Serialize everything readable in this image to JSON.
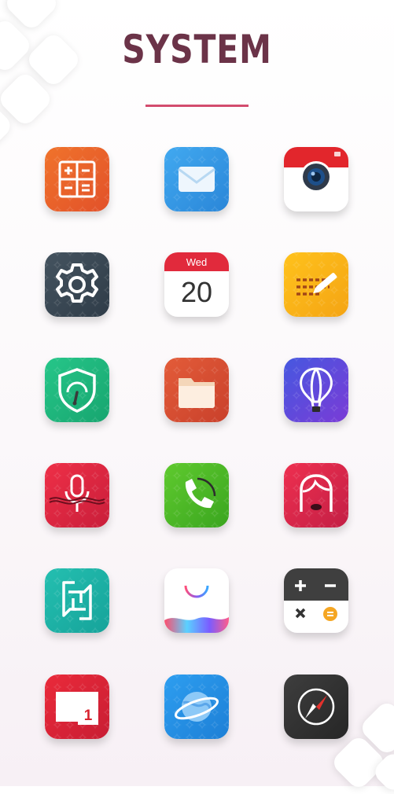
{
  "header": {
    "title": "SYSTEM"
  },
  "calendar_icon": {
    "day": "Wed",
    "date": "20"
  },
  "date_icon": {
    "number": "1"
  },
  "colors": {
    "title": "#6b3348",
    "accent_line": "#d34c6e"
  },
  "apps": [
    {
      "icon": "calculator-icon"
    },
    {
      "icon": "mail-icon"
    },
    {
      "icon": "camera-icon"
    },
    {
      "icon": "settings-gear-icon"
    },
    {
      "icon": "calendar-icon"
    },
    {
      "icon": "notes-icon"
    },
    {
      "icon": "security-shield-icon"
    },
    {
      "icon": "files-folder-icon"
    },
    {
      "icon": "hot-air-balloon-icon"
    },
    {
      "icon": "voice-recorder-icon"
    },
    {
      "icon": "phone-icon"
    },
    {
      "icon": "contacts-icon"
    },
    {
      "icon": "share-transfer-icon"
    },
    {
      "icon": "app-store-icon"
    },
    {
      "icon": "calculator-dark-icon"
    },
    {
      "icon": "date-icon"
    },
    {
      "icon": "browser-icon"
    },
    {
      "icon": "compass-icon"
    }
  ]
}
